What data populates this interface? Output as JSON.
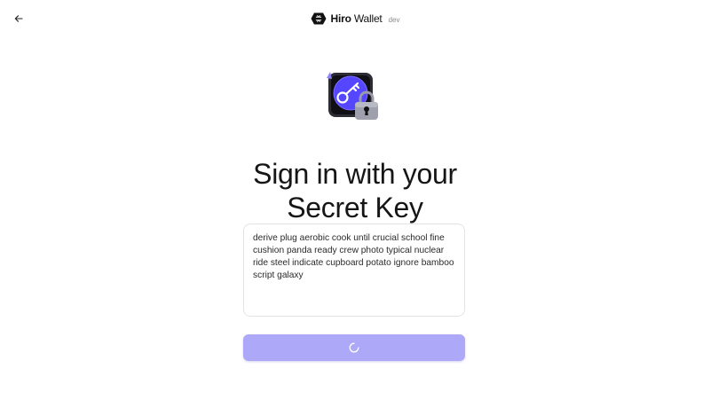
{
  "header": {
    "back_icon": "arrow-left-icon",
    "brand_icon": "hiro-logo-icon",
    "brand_name_bold": "Hiro",
    "brand_name_light": "Wallet",
    "brand_env": "dev"
  },
  "main": {
    "illustration_icon": "key-lock-icon",
    "title_line1": "Sign in with your",
    "title_line2": "Secret Key",
    "secret_key_value": "derive plug aerobic cook until crucial school fine cushion panda ready crew photo typical nuclear ride steel indicate cupboard potato ignore bamboo script galaxy",
    "submit_icon": "loading-spinner-icon"
  },
  "colors": {
    "button_bg": "#aea8f8",
    "accent": "#5546ff",
    "text": "#161616"
  }
}
